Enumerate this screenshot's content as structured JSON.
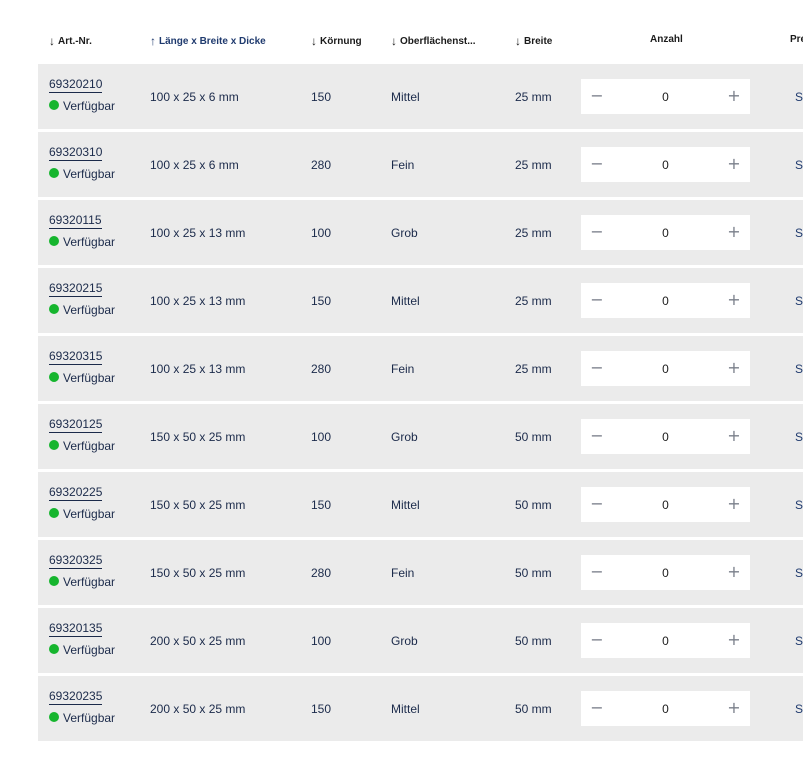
{
  "headers": [
    {
      "arrow": "↓",
      "label": "Art.-Nr.",
      "active": false
    },
    {
      "arrow": "↑",
      "label": "Länge x Breite x Dicke",
      "active": true
    },
    {
      "arrow": "↓",
      "label": "Körnung",
      "active": false
    },
    {
      "arrow": "↓",
      "label": "Oberflächenst...",
      "active": false
    },
    {
      "arrow": "↓",
      "label": "Breite",
      "active": false
    },
    {
      "arrow": "",
      "label": "Anzahl",
      "active": false
    },
    {
      "arrow": "",
      "label": "Pre",
      "active": false
    }
  ],
  "status_color": "#16b52e",
  "rows": [
    {
      "artnr": "69320210",
      "status": "Verfügbar",
      "dims": "100 x 25 x 6 mm",
      "grit": "150",
      "surface": "Mittel",
      "width": "25 mm",
      "qty": "0",
      "price": "S"
    },
    {
      "artnr": "69320310",
      "status": "Verfügbar",
      "dims": "100 x 25 x 6 mm",
      "grit": "280",
      "surface": "Fein",
      "width": "25 mm",
      "qty": "0",
      "price": "S"
    },
    {
      "artnr": "69320115",
      "status": "Verfügbar",
      "dims": "100 x 25 x 13 mm",
      "grit": "100",
      "surface": "Grob",
      "width": "25 mm",
      "qty": "0",
      "price": "S"
    },
    {
      "artnr": "69320215",
      "status": "Verfügbar",
      "dims": "100 x 25 x 13 mm",
      "grit": "150",
      "surface": "Mittel",
      "width": "25 mm",
      "qty": "0",
      "price": "S"
    },
    {
      "artnr": "69320315",
      "status": "Verfügbar",
      "dims": "100 x 25 x 13 mm",
      "grit": "280",
      "surface": "Fein",
      "width": "25 mm",
      "qty": "0",
      "price": "S"
    },
    {
      "artnr": "69320125",
      "status": "Verfügbar",
      "dims": "150 x 50 x 25 mm",
      "grit": "100",
      "surface": "Grob",
      "width": "50 mm",
      "qty": "0",
      "price": "S"
    },
    {
      "artnr": "69320225",
      "status": "Verfügbar",
      "dims": "150 x 50 x 25 mm",
      "grit": "150",
      "surface": "Mittel",
      "width": "50 mm",
      "qty": "0",
      "price": "S"
    },
    {
      "artnr": "69320325",
      "status": "Verfügbar",
      "dims": "150 x 50 x 25 mm",
      "grit": "280",
      "surface": "Fein",
      "width": "50 mm",
      "qty": "0",
      "price": "S"
    },
    {
      "artnr": "69320135",
      "status": "Verfügbar",
      "dims": "200 x 50 x 25 mm",
      "grit": "100",
      "surface": "Grob",
      "width": "50 mm",
      "qty": "0",
      "price": "S"
    },
    {
      "artnr": "69320235",
      "status": "Verfügbar",
      "dims": "200 x 50 x 25 mm",
      "grit": "150",
      "surface": "Mittel",
      "width": "50 mm",
      "qty": "0",
      "price": "S"
    }
  ]
}
